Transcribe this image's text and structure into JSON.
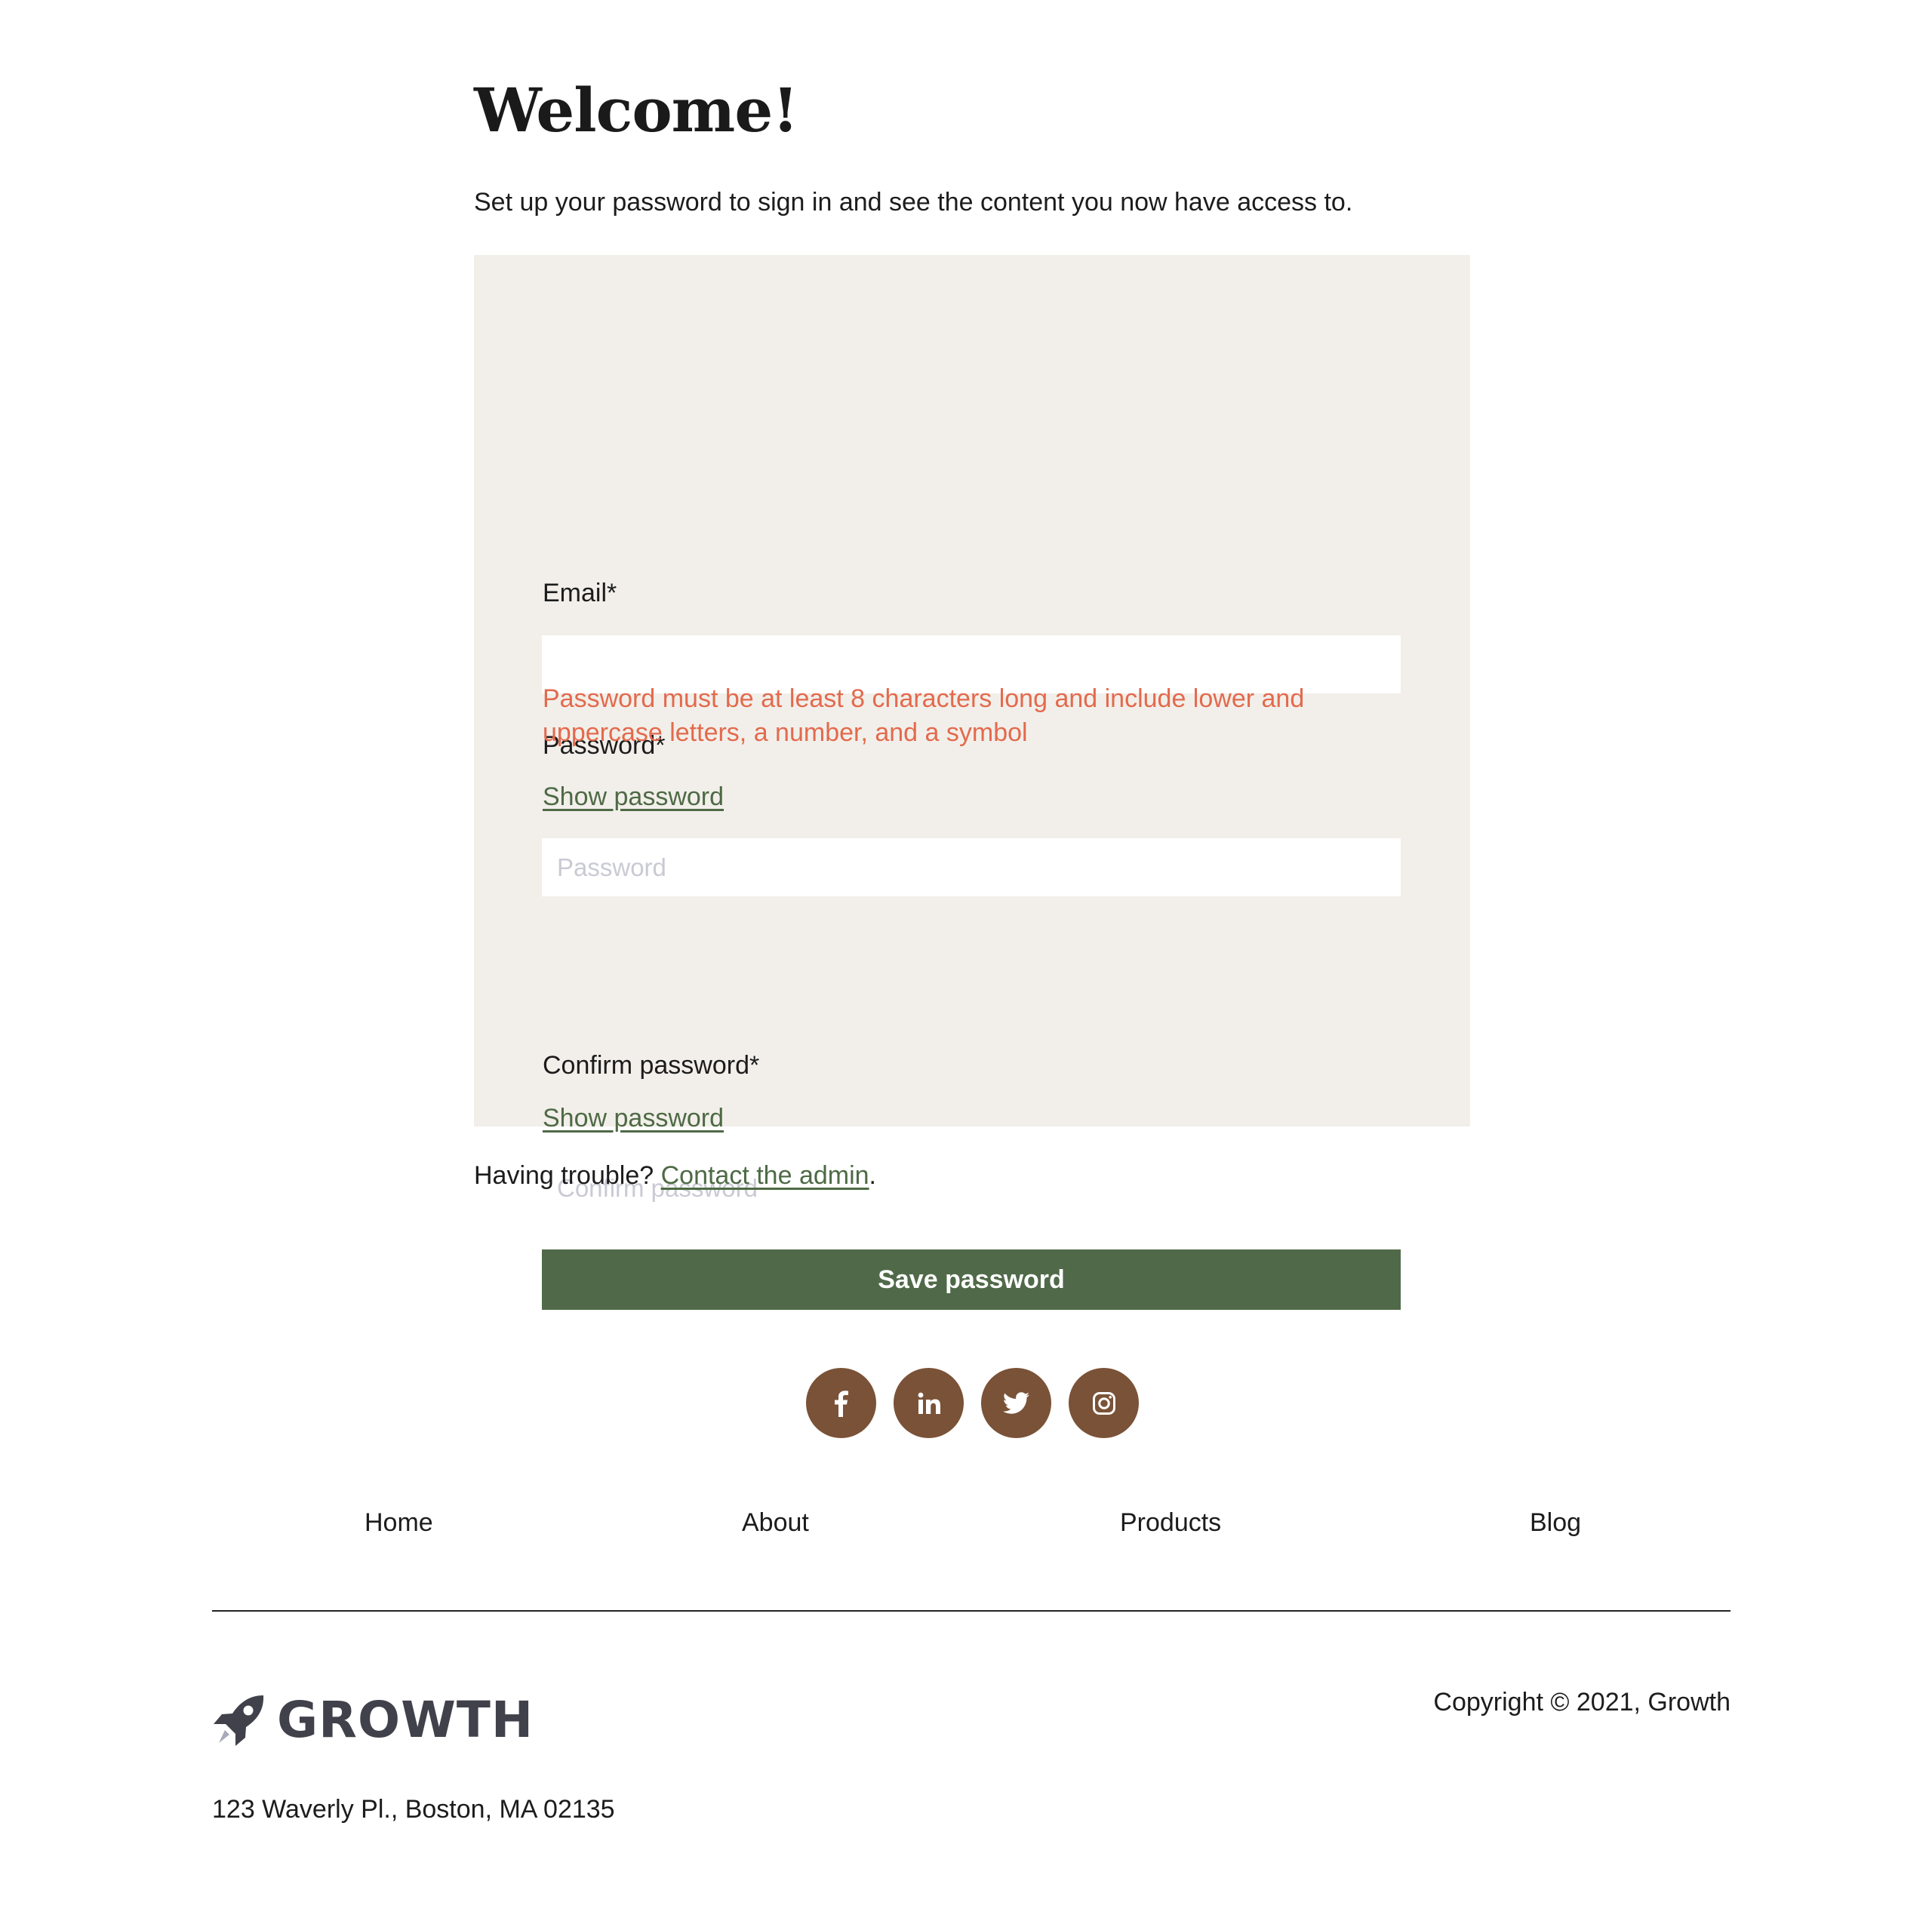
{
  "main": {
    "title": "Welcome!",
    "intro": "Set up your password to sign in and see the content you now have access to."
  },
  "form": {
    "email_label": "Email*",
    "email_value": "",
    "password_label": "Password*",
    "show_password_label": "Show password",
    "password_placeholder": "Password",
    "password_error": "Password must be at least 8 characters long and include lower and uppercase letters, a number, and a symbol",
    "confirm_label": "Confirm password*",
    "confirm_show_password_label": "Show password",
    "confirm_placeholder": "Confirm password",
    "save_label": "Save password"
  },
  "help": {
    "prefix": "Having trouble? ",
    "link_label": "Contact the admin",
    "suffix": "."
  },
  "footer": {
    "social": [
      {
        "icon": "facebook-icon"
      },
      {
        "icon": "linkedin-icon"
      },
      {
        "icon": "twitter-icon"
      },
      {
        "icon": "instagram-icon"
      }
    ],
    "nav": [
      "Home",
      "About",
      "Products",
      "Blog"
    ],
    "logo_text": "GROWTH",
    "copyright": "Copyright © 2021, Growth",
    "address": "123 Waverly Pl., Boston, MA 02135"
  },
  "colors": {
    "accent_green": "#506a49",
    "link_green": "#4e6a45",
    "error": "#e36a4d",
    "card_background": "#f2efea",
    "social_brown": "#7a5237",
    "logo_gray": "#40414a"
  }
}
